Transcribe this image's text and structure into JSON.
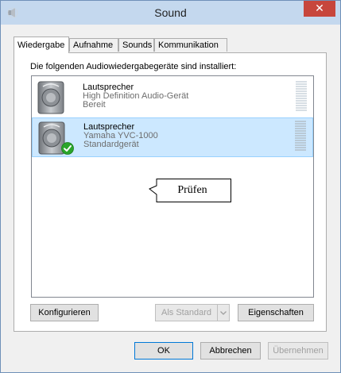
{
  "window": {
    "title": "Sound",
    "close_glyph": "✕"
  },
  "tabs": [
    {
      "label": "Wiedergabe",
      "active": true
    },
    {
      "label": "Aufnahme",
      "active": false
    },
    {
      "label": "Sounds",
      "active": false
    },
    {
      "label": "Kommunikation",
      "active": false
    }
  ],
  "panel": {
    "heading": "Die folgenden Audiowiedergabegeräte sind installiert:",
    "devices": [
      {
        "name": "Lautsprecher",
        "description": "High Definition Audio-Gerät",
        "status": "Bereit",
        "selected": false,
        "default": false
      },
      {
        "name": "Lautsprecher",
        "description": "Yamaha YVC-1000",
        "status": "Standardgerät",
        "selected": true,
        "default": true
      }
    ],
    "tooltip": "Prüfen"
  },
  "panel_buttons": {
    "configure": "Konfigurieren",
    "set_default": "Als Standard",
    "properties": "Eigenschaften"
  },
  "dialog_buttons": {
    "ok": "OK",
    "cancel": "Abbrechen",
    "apply": "Übernehmen"
  },
  "colors": {
    "accent": "#0078d7",
    "close": "#c7463c",
    "titlebar": "#c4d8ee",
    "selection": "#cce8ff",
    "check": "#2aa52a"
  },
  "icons": {
    "app": "sound-app-icon",
    "device": "speaker-icon",
    "default_marker": "check-icon",
    "meter": "level-meter-icon",
    "dropdown": "chevron-down-icon"
  }
}
